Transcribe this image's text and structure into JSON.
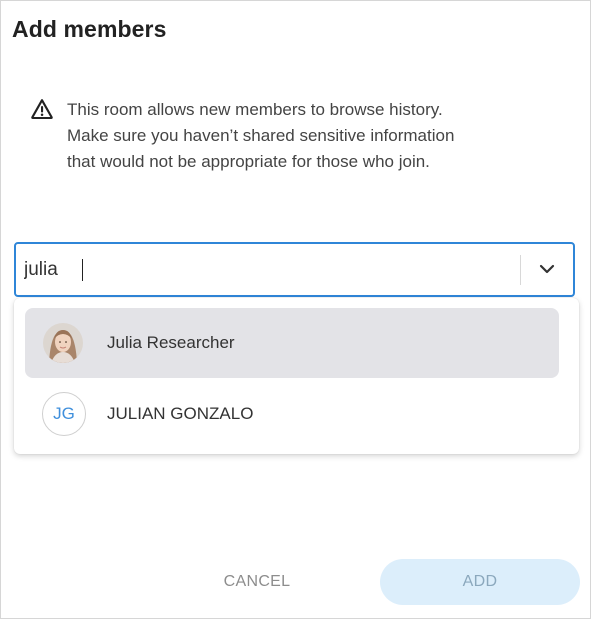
{
  "dialog": {
    "title": "Add members",
    "warning": {
      "icon": "warning-icon",
      "line1": "This room allows new members to browse history.",
      "line2": "Make sure you haven’t shared sensitive information",
      "line3": "that would not be appropriate for those who join."
    },
    "search": {
      "value": "julia",
      "toggle_icon": "chevron-down-icon"
    },
    "suggestions": [
      {
        "name": "Julia Researcher",
        "avatar": "photo",
        "highlighted": true
      },
      {
        "name": "JULIAN GONZALO",
        "initials": "JG",
        "highlighted": false
      }
    ],
    "buttons": {
      "cancel": "CANCEL",
      "add": "ADD"
    }
  },
  "colors": {
    "accent": "#2f86d8",
    "initials": "#3f8fdc",
    "highlight": "#e3e3e7",
    "add_disabled_bg": "#dceefb"
  }
}
